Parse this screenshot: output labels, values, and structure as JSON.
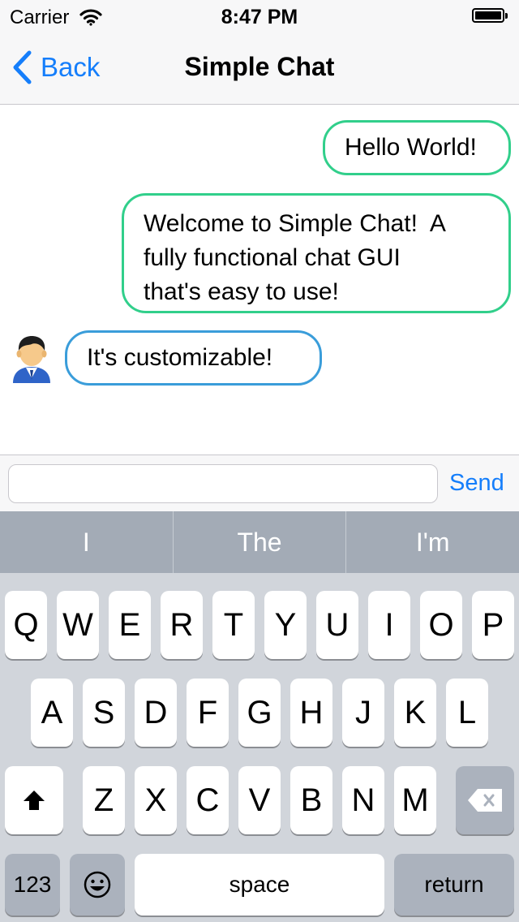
{
  "status_bar": {
    "carrier": "Carrier",
    "time": "8:47 PM",
    "battery_icon": "battery-full-icon",
    "wifi_icon": "wifi-icon"
  },
  "nav": {
    "back_label": "Back",
    "title": "Simple Chat",
    "back_icon": "chevron-left-icon"
  },
  "messages": [
    {
      "direction": "sent",
      "text": "Hello World!"
    },
    {
      "direction": "sent",
      "lines": [
        "Welcome to Simple Chat!  A",
        "fully functional chat GUI",
        "that's easy to use!"
      ]
    },
    {
      "direction": "received",
      "text": "It's customizable!",
      "avatar": "user-avatar-icon"
    }
  ],
  "composer": {
    "input_value": "",
    "send_label": "Send"
  },
  "keyboard": {
    "suggestions": [
      "I",
      "The",
      "I'm"
    ],
    "row1": [
      "Q",
      "W",
      "E",
      "R",
      "T",
      "Y",
      "U",
      "I",
      "O",
      "P"
    ],
    "row2": [
      "A",
      "S",
      "D",
      "F",
      "G",
      "H",
      "J",
      "K",
      "L"
    ],
    "row3": [
      "Z",
      "X",
      "C",
      "V",
      "B",
      "N",
      "M"
    ],
    "numbers_label": "123",
    "space_label": "space",
    "return_label": "return",
    "shift_icon": "shift-icon",
    "delete_icon": "backspace-icon",
    "emoji_icon": "emoji-icon"
  },
  "colors": {
    "accent": "#157efb",
    "sent_border": "#31cf8b",
    "received_border": "#3a9dda",
    "keyboard_bg": "#d1d5db",
    "suggest_bg": "#a3abb6"
  }
}
